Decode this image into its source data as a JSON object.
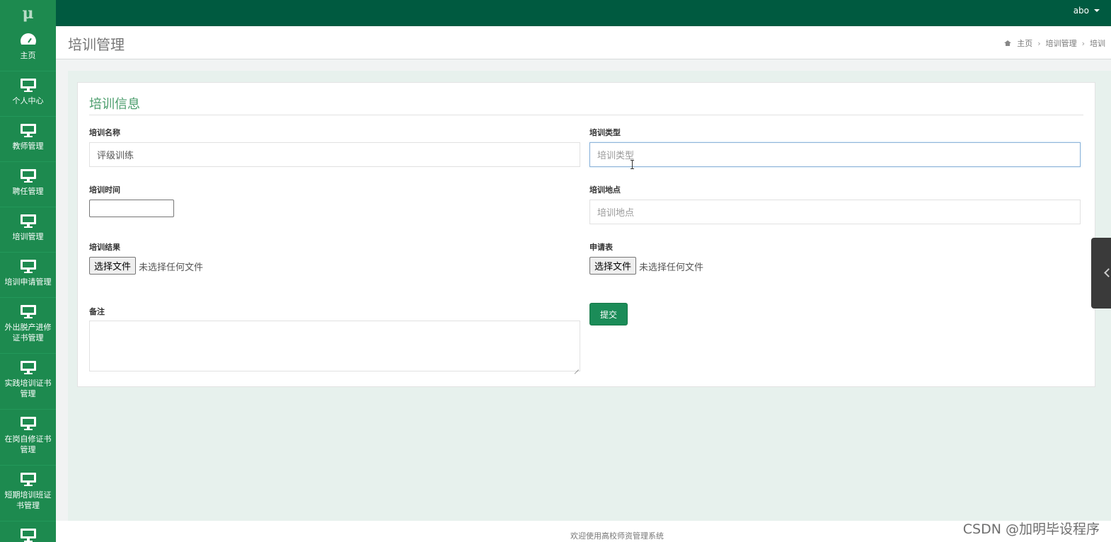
{
  "app": {
    "logo": "μ",
    "user": "abo"
  },
  "sidebar": {
    "items": [
      {
        "label": "主页",
        "icon": "dashboard-icon"
      },
      {
        "label": "个人中心",
        "icon": "monitor-icon"
      },
      {
        "label": "教师管理",
        "icon": "monitor-icon"
      },
      {
        "label": "聘任管理",
        "icon": "monitor-icon"
      },
      {
        "label": "培训管理",
        "icon": "monitor-icon"
      },
      {
        "label": "培训申请管理",
        "icon": "monitor-icon"
      },
      {
        "label": "外出脱产进修证书管理",
        "icon": "monitor-icon"
      },
      {
        "label": "实践培训证书管理",
        "icon": "monitor-icon"
      },
      {
        "label": "在岗自修证书管理",
        "icon": "monitor-icon"
      },
      {
        "label": "短期培训班证书管理",
        "icon": "monitor-icon"
      },
      {
        "label": "",
        "icon": "monitor-icon"
      }
    ]
  },
  "header": {
    "title": "培训管理",
    "breadcrumb": [
      "主页",
      "培训管理",
      "培训"
    ]
  },
  "form": {
    "title": "培训信息",
    "name_label": "培训名称",
    "name_value": "评级训练",
    "type_label": "培训类型",
    "type_placeholder": "培训类型",
    "time_label": "培训时间",
    "location_label": "培训地点",
    "location_placeholder": "培训地点",
    "result_label": "培训结果",
    "result_button": "选择文件",
    "result_file": "未选择任何文件",
    "application_label": "申请表",
    "application_button": "选择文件",
    "application_file": "未选择任何文件",
    "notes_label": "备注",
    "submit_label": "提交"
  },
  "footer": {
    "text": "欢迎使用高校师资管理系统"
  },
  "watermark": "CSDN @加明毕设程序",
  "colors": {
    "topbar": "#005a40",
    "sidebar": "#1d8a4f",
    "accent": "#4b9d6c",
    "button": "#1b8c58"
  }
}
